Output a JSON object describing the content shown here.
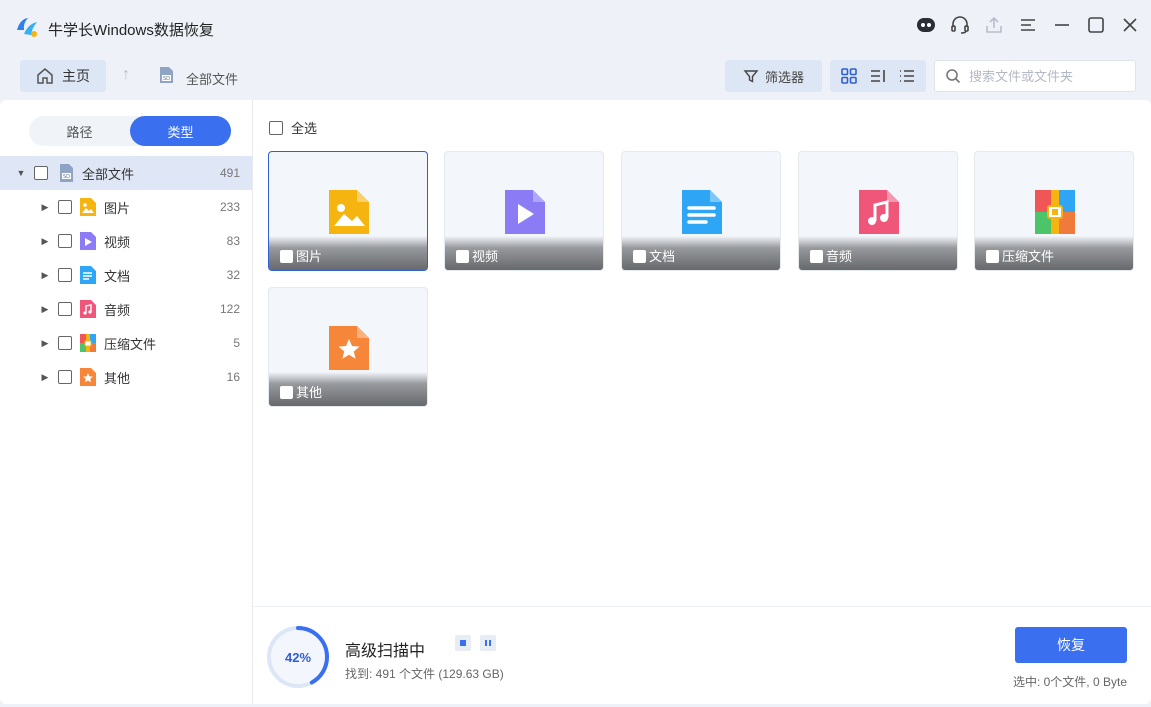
{
  "app": {
    "title": "牛学长Windows数据恢复"
  },
  "toolbar": {
    "home_label": "主页",
    "breadcrumb": "全部文件",
    "filter_label": "筛选器",
    "search_placeholder": "搜索文件或文件夹"
  },
  "sidebar": {
    "tabs": [
      {
        "label": "路径",
        "active": false
      },
      {
        "label": "类型",
        "active": true
      }
    ],
    "root": {
      "label": "全部文件",
      "count": "491"
    },
    "items": [
      {
        "label": "图片",
        "count": "233",
        "icon": "image-icon"
      },
      {
        "label": "视频",
        "count": "83",
        "icon": "video-icon"
      },
      {
        "label": "文档",
        "count": "32",
        "icon": "document-icon"
      },
      {
        "label": "音频",
        "count": "122",
        "icon": "audio-icon"
      },
      {
        "label": "压缩文件",
        "count": "5",
        "icon": "archive-icon"
      },
      {
        "label": "其他",
        "count": "16",
        "icon": "other-icon"
      }
    ]
  },
  "content": {
    "select_all_label": "全选",
    "cards": [
      {
        "label": "图片",
        "icon": "image-icon",
        "color": "#f5b40f"
      },
      {
        "label": "视频",
        "icon": "video-icon",
        "color": "#8b7cf6"
      },
      {
        "label": "文档",
        "icon": "document-icon",
        "color": "#2ea6f5"
      },
      {
        "label": "音频",
        "icon": "audio-icon",
        "color": "#f0567a"
      },
      {
        "label": "压缩文件",
        "icon": "archive-icon",
        "color": "#f07a3a"
      },
      {
        "label": "其他",
        "icon": "other-icon",
        "color": "#f5863a"
      }
    ]
  },
  "scan": {
    "progress_percent": 42,
    "progress_label": "42%",
    "title": "高级扫描中",
    "found_text": "找到: 491 个文件 (129.63 GB)"
  },
  "footer": {
    "recover_label": "恢复",
    "selected_text": "选中: 0个文件, 0 Byte"
  },
  "colors": {
    "accent": "#3a6ff0",
    "selected_row": "#dfe7f7"
  }
}
